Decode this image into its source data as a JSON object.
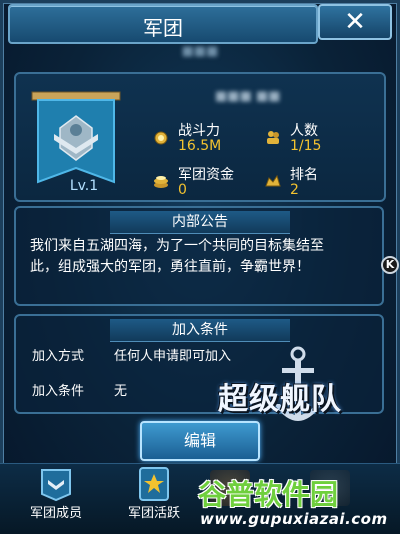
{
  "window": {
    "title": "军团",
    "close_symbol": "✕"
  },
  "guild": {
    "name_blurred": "■■■",
    "leader_blurred": "■■■ ■■",
    "level": "Lv.1"
  },
  "stats": [
    {
      "icon": "medal-icon",
      "label": "战斗力",
      "value": "16.5M"
    },
    {
      "icon": "people-icon",
      "label": "人数",
      "value": "1/15"
    },
    {
      "icon": "coins-icon",
      "label": "军团资金",
      "value": "0"
    },
    {
      "icon": "rank-icon",
      "label": "排名",
      "value": "2"
    }
  ],
  "notice": {
    "heading": "内部公告",
    "lines": [
      "我们来自五湖四海，为了一个共同的目标集结至",
      "此，组成强大的军团，勇往直前，争霸世界！"
    ]
  },
  "join": {
    "heading": "加入条件",
    "rows": [
      {
        "label": "加入方式",
        "value": "任何人申请即可加入"
      },
      {
        "label": "加入条件",
        "value": "无"
      }
    ]
  },
  "edit_button": "编辑",
  "tabs": [
    {
      "label": "军团成员",
      "icon": "members-icon"
    },
    {
      "label": "军团活跃",
      "icon": "activity-icon"
    }
  ],
  "side_badge": "K",
  "watermarks": {
    "game_logo": "超级舰队",
    "site_cn": "谷普软件园",
    "site_url": "www.gupuxiazai.com"
  },
  "colors": {
    "accent_gold": "#f2c230",
    "panel_border": "#3a6f95",
    "button_blue": "#3f9ad0"
  }
}
